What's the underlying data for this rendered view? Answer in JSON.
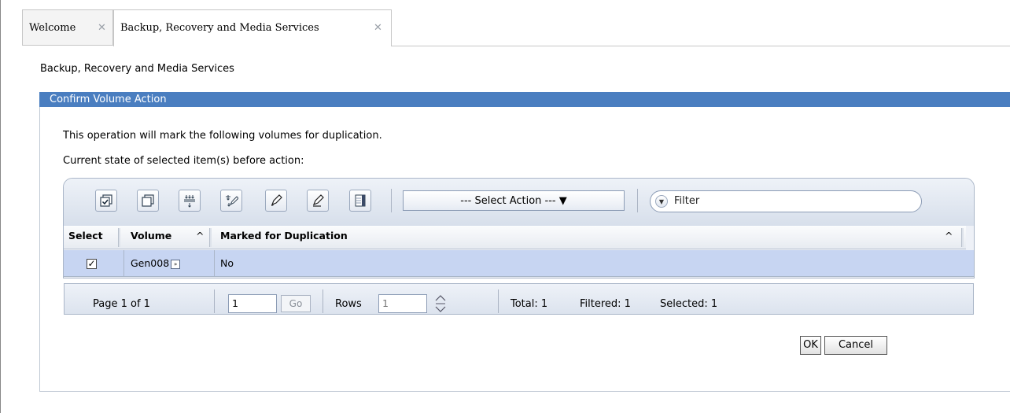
{
  "tabs": [
    {
      "label": "Welcome",
      "close": "✕"
    },
    {
      "label": "Backup, Recovery and Media Services",
      "close": "✕"
    }
  ],
  "page_title": "Backup, Recovery and Media Services",
  "panel": {
    "title": "Confirm Volume Action",
    "message": "This operation will mark the following volumes for duplication.",
    "state_label": "Current state of selected item(s) before action:"
  },
  "toolbar": {
    "select_action": "--- Select Action --- ▼",
    "filter_placeholder": "Filter"
  },
  "table": {
    "columns": [
      "Select",
      "Volume",
      "Marked for Duplication"
    ],
    "sort_indicator": "^",
    "rows": [
      {
        "checked": "✓",
        "volume": "Gen008",
        "marked": "No"
      }
    ]
  },
  "pager": {
    "page_text": "Page 1 of 1",
    "page_input": "1",
    "go_label": "Go",
    "rows_label": "Rows",
    "rows_input": "1",
    "total": "Total: 1",
    "filtered": "Filtered: 1",
    "selected": "Selected: 1"
  },
  "buttons": {
    "ok": "OK",
    "cancel": "Cancel"
  },
  "colors": {
    "panel_header": "#4a7ec0",
    "row_selected": "#c7d5f2"
  }
}
